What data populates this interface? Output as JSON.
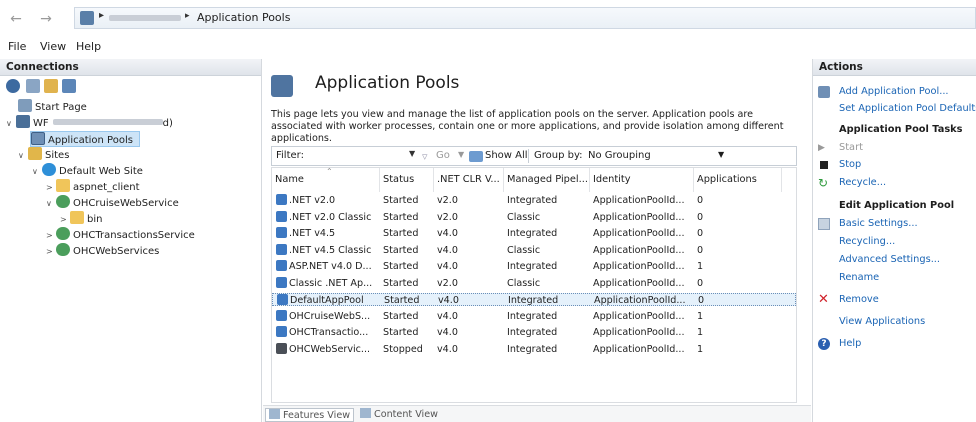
{
  "address": {
    "breadcrumb": "Application Pools"
  },
  "menu": {
    "file": "File",
    "view": "View",
    "help": "Help"
  },
  "connections": {
    "header": "Connections",
    "tree": {
      "start_page": "Start Page",
      "server_prefix": "WF",
      "server_suffix": "d)",
      "application_pools": "Application Pools",
      "sites": "Sites",
      "default_web_site": "Default Web Site",
      "aspnet_client": "aspnet_client",
      "ohc_cruise": "OHCruiseWebService",
      "bin": "bin",
      "ohc_transactions": "OHCTransactionsService",
      "ohc_web": "OHCWebServices"
    }
  },
  "main": {
    "title": "Application Pools",
    "description": "This page lets you view and manage the list of application pools on the server. Application pools are associated with worker processes, contain one or more applications, and provide isolation among different applications.",
    "filter_label": "Filter:",
    "go_label": "Go",
    "show_all_label": "Show All",
    "group_by_label": "Group by:",
    "group_by_value": "No Grouping",
    "columns": [
      "Name",
      "Status",
      ".NET CLR V...",
      "Managed Pipel...",
      "Identity",
      "Applications"
    ],
    "rows": [
      {
        "name": ".NET v2.0",
        "status": "Started",
        "clr": "v2.0",
        "pipeline": "Integrated",
        "identity": "ApplicationPoolId...",
        "apps": "0"
      },
      {
        "name": ".NET v2.0 Classic",
        "status": "Started",
        "clr": "v2.0",
        "pipeline": "Classic",
        "identity": "ApplicationPoolId...",
        "apps": "0"
      },
      {
        "name": ".NET v4.5",
        "status": "Started",
        "clr": "v4.0",
        "pipeline": "Integrated",
        "identity": "ApplicationPoolId...",
        "apps": "0"
      },
      {
        "name": ".NET v4.5 Classic",
        "status": "Started",
        "clr": "v4.0",
        "pipeline": "Classic",
        "identity": "ApplicationPoolId...",
        "apps": "0"
      },
      {
        "name": "ASP.NET v4.0 D...",
        "status": "Started",
        "clr": "v4.0",
        "pipeline": "Integrated",
        "identity": "ApplicationPoolId...",
        "apps": "1"
      },
      {
        "name": "Classic .NET Ap...",
        "status": "Started",
        "clr": "v2.0",
        "pipeline": "Classic",
        "identity": "ApplicationPoolId...",
        "apps": "0"
      },
      {
        "name": "DefaultAppPool",
        "status": "Started",
        "clr": "v4.0",
        "pipeline": "Integrated",
        "identity": "ApplicationPoolId...",
        "apps": "0"
      },
      {
        "name": "OHCruiseWebS...",
        "status": "Started",
        "clr": "v4.0",
        "pipeline": "Integrated",
        "identity": "ApplicationPoolId...",
        "apps": "1"
      },
      {
        "name": "OHCTransactio...",
        "status": "Started",
        "clr": "v4.0",
        "pipeline": "Integrated",
        "identity": "ApplicationPoolId...",
        "apps": "1"
      },
      {
        "name": "OHCWebServic...",
        "status": "Stopped",
        "clr": "v4.0",
        "pipeline": "Integrated",
        "identity": "ApplicationPoolId...",
        "apps": "1"
      }
    ],
    "tabs": {
      "features_view": "Features View",
      "content_view": "Content View"
    }
  },
  "actions": {
    "header": "Actions",
    "add_pool": "Add Application Pool...",
    "set_defaults": "Set Application Pool Defaults...",
    "pool_tasks_heading": "Application Pool Tasks",
    "start": "Start",
    "stop": "Stop",
    "recycle": "Recycle...",
    "edit_heading": "Edit Application Pool",
    "basic_settings": "Basic Settings...",
    "recycling": "Recycling...",
    "advanced_settings": "Advanced Settings...",
    "rename": "Rename",
    "remove": "Remove",
    "view_applications": "View Applications",
    "help": "Help"
  },
  "colors": {
    "link": "#1a64b4",
    "selection": "#cde4f7",
    "remove_red": "#d0222a"
  }
}
